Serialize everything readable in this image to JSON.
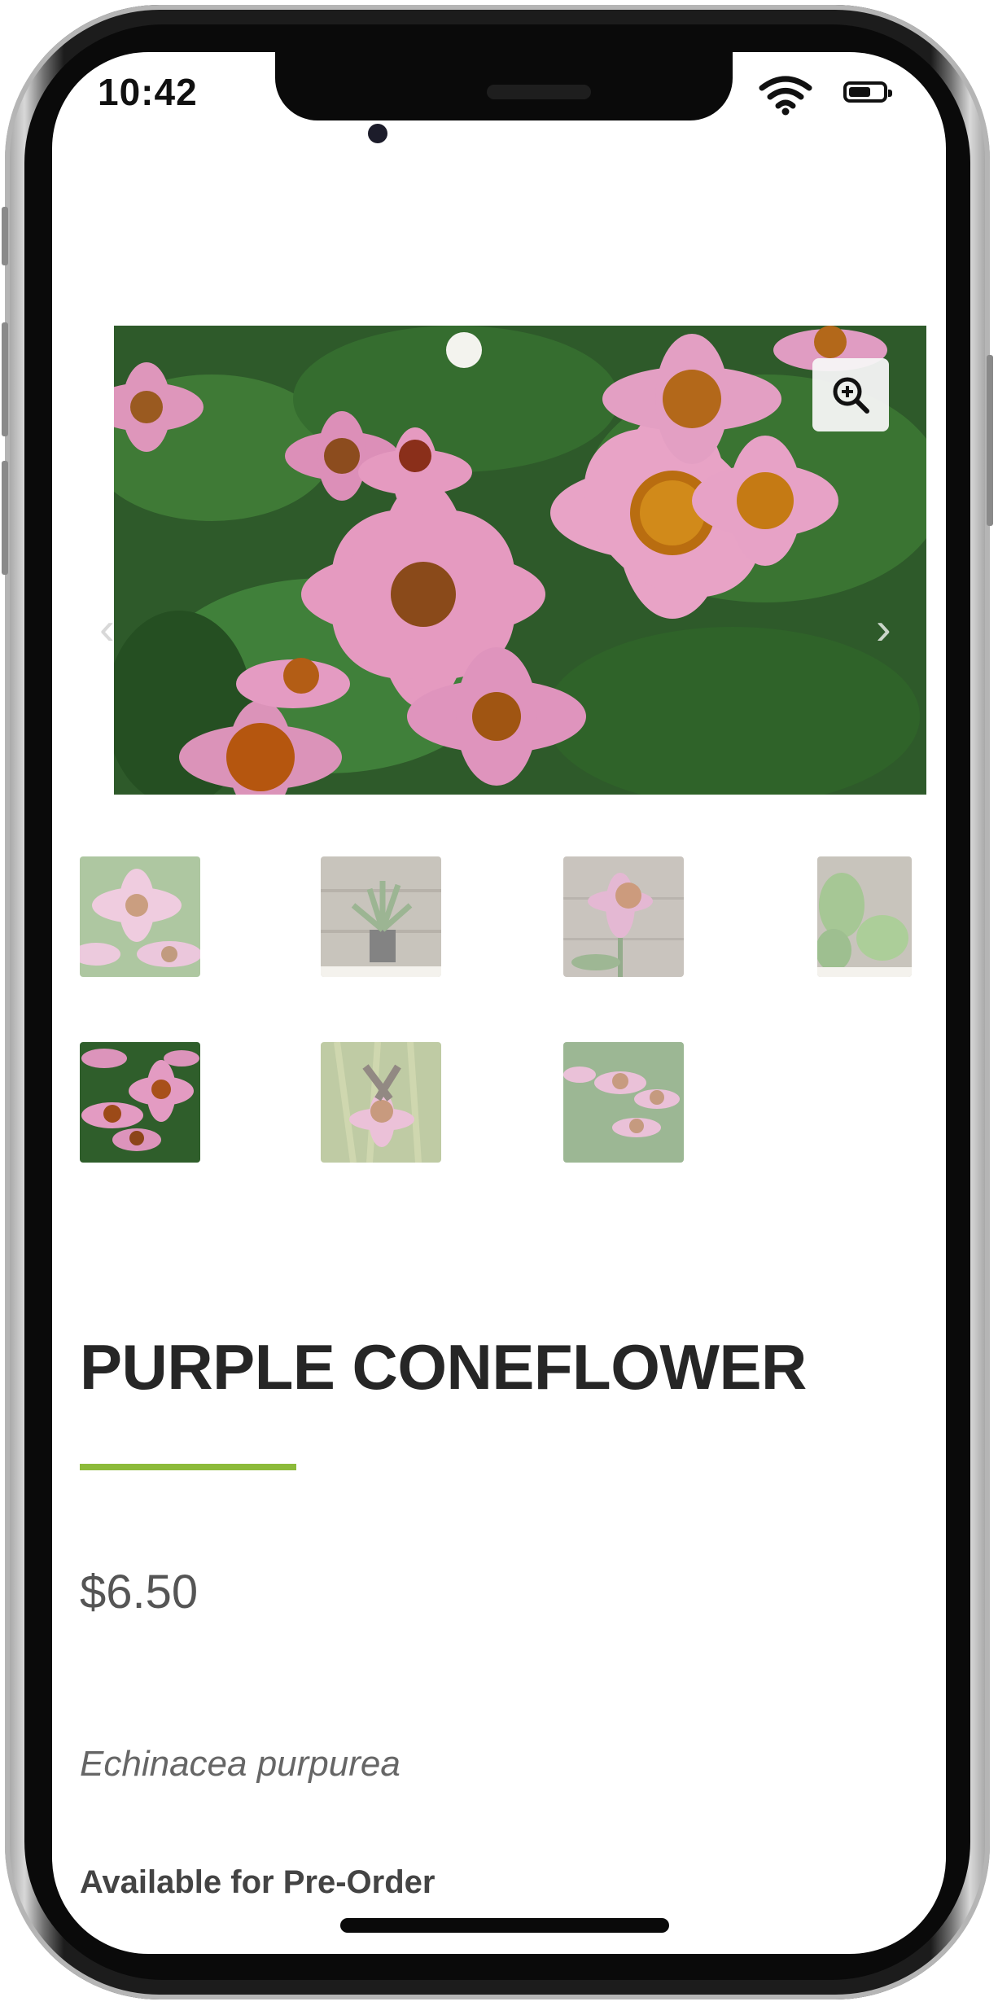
{
  "status_bar": {
    "time": "10:42"
  },
  "product": {
    "title": "PURPLE CONEFLOWER",
    "price": "$6.50",
    "scientific_name": "Echinacea purpurea",
    "availability": "Available for Pre-Order"
  },
  "gallery": {
    "thumbnail_count": 7,
    "selected_index": 4
  },
  "colors": {
    "accent": "#8cba3a",
    "title": "#262626",
    "price": "#555555"
  },
  "icons": [
    "wifi-icon",
    "battery-icon",
    "zoom-in-icon",
    "chevron-left-icon",
    "chevron-right-icon"
  ]
}
